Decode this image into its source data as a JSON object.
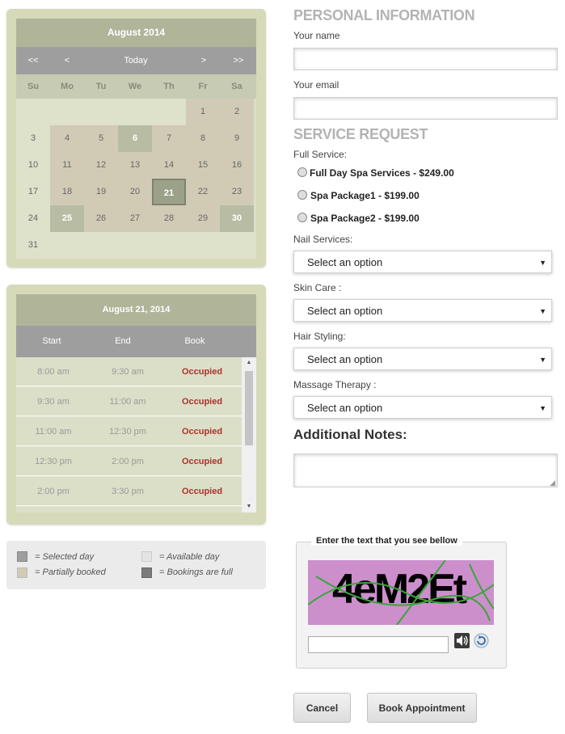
{
  "calendar": {
    "month_title": "August 2014",
    "nav": {
      "prev_year": "<<",
      "prev_month": "<",
      "today": "Today",
      "next_month": ">",
      "next_year": ">>"
    },
    "weekdays": [
      "Su",
      "Mo",
      "Tu",
      "We",
      "Th",
      "Fr",
      "Sa"
    ],
    "days": [
      {
        "day": "1",
        "state": "partial"
      },
      {
        "day": "2",
        "state": "partial"
      },
      {
        "day": "3",
        "state": "avail"
      },
      {
        "day": "4",
        "state": "partial"
      },
      {
        "day": "5",
        "state": "partial"
      },
      {
        "day": "6",
        "state": "full"
      },
      {
        "day": "7",
        "state": "partial"
      },
      {
        "day": "8",
        "state": "partial"
      },
      {
        "day": "9",
        "state": "partial"
      },
      {
        "day": "10",
        "state": "avail"
      },
      {
        "day": "11",
        "state": "partial"
      },
      {
        "day": "12",
        "state": "partial"
      },
      {
        "day": "13",
        "state": "partial"
      },
      {
        "day": "14",
        "state": "partial"
      },
      {
        "day": "15",
        "state": "partial"
      },
      {
        "day": "16",
        "state": "partial"
      },
      {
        "day": "17",
        "state": "avail"
      },
      {
        "day": "18",
        "state": "partial"
      },
      {
        "day": "19",
        "state": "partial"
      },
      {
        "day": "20",
        "state": "partial"
      },
      {
        "day": "21",
        "state": "selected"
      },
      {
        "day": "22",
        "state": "partial"
      },
      {
        "day": "23",
        "state": "partial"
      },
      {
        "day": "24",
        "state": "avail"
      },
      {
        "day": "25",
        "state": "full"
      },
      {
        "day": "26",
        "state": "partial"
      },
      {
        "day": "27",
        "state": "partial"
      },
      {
        "day": "28",
        "state": "partial"
      },
      {
        "day": "29",
        "state": "partial"
      },
      {
        "day": "30",
        "state": "full"
      },
      {
        "day": "31",
        "state": "avail"
      }
    ]
  },
  "slots": {
    "date_title": "August 21, 2014",
    "headers": {
      "start": "Start",
      "end": "End",
      "book": "Book"
    },
    "rows": [
      {
        "start": "8:00 am",
        "end": "9:30 am",
        "status": "Occupied"
      },
      {
        "start": "9:30 am",
        "end": "11:00 am",
        "status": "Occupied"
      },
      {
        "start": "11:00 am",
        "end": "12:30 pm",
        "status": "Occupied"
      },
      {
        "start": "12:30 pm",
        "end": "2:00 pm",
        "status": "Occupied"
      },
      {
        "start": "2:00 pm",
        "end": "3:30 pm",
        "status": "Occupied"
      }
    ]
  },
  "legend": {
    "selected": "= Selected day",
    "available": "= Available day",
    "partial": "= Partially booked",
    "full": "= Bookings are full"
  },
  "personal": {
    "title": "PERSONAL INFORMATION",
    "name_label": "Your name",
    "name_value": "",
    "email_label": "Your email",
    "email_value": ""
  },
  "service": {
    "title": "SERVICE REQUEST",
    "full_service_label": "Full Service:",
    "options": [
      "Full Day Spa Services - $249.00",
      "Spa Package1 - $199.00",
      "Spa Package2 - $199.00"
    ],
    "selects": [
      {
        "label": "Nail Services:",
        "value": "Select an option"
      },
      {
        "label": "Skin Care :",
        "value": "Select an option"
      },
      {
        "label": "Hair Styling:",
        "value": "Select an option"
      },
      {
        "label": "Massage Therapy :",
        "value": "Select an option"
      }
    ]
  },
  "notes": {
    "title": "Additional Notes:",
    "value": ""
  },
  "captcha": {
    "legend": "Enter the text that you see bellow",
    "text": "4eM2Et",
    "input_value": ""
  },
  "buttons": {
    "cancel": "Cancel",
    "book": "Book Appointment"
  }
}
